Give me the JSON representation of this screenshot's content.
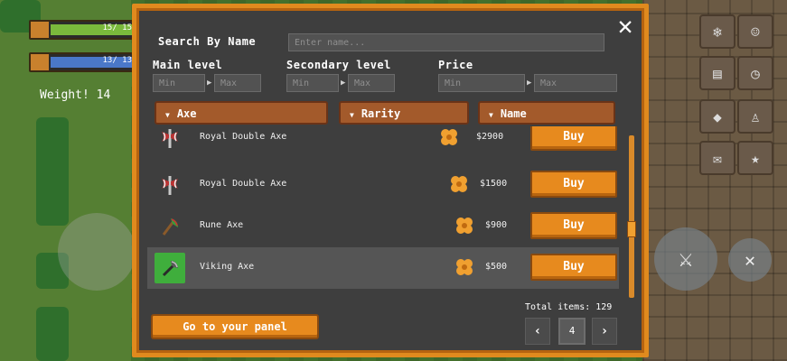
{
  "hud": {
    "health_text": "15/ 15",
    "mana_text": "13/ 13",
    "weight_label": "Weight! 14"
  },
  "shop": {
    "close_label": "✕",
    "search": {
      "label": "Search By Name",
      "placeholder": "Enter name..."
    },
    "filters": {
      "main_level": {
        "label": "Main level",
        "min_placeholder": "Min",
        "max_placeholder": "Max"
      },
      "secondary_level": {
        "label": "Secondary level",
        "min_placeholder": "Min",
        "max_placeholder": "Max"
      },
      "price": {
        "label": "Price",
        "min_placeholder": "Min",
        "max_placeholder": "Max"
      },
      "separator": "▶"
    },
    "dropdowns": [
      {
        "label": "Axe",
        "caret": "▼"
      },
      {
        "label": "Rarity",
        "caret": "▼"
      },
      {
        "label": "Name",
        "caret": "▼"
      }
    ],
    "items": [
      {
        "name": "Royal Double Axe",
        "price": "$2900",
        "buy_label": "Buy",
        "icon": "double-axe-icon",
        "selected": false
      },
      {
        "name": "Royal Double Axe",
        "price": "$1500",
        "buy_label": "Buy",
        "icon": "double-axe-icon",
        "selected": false
      },
      {
        "name": "Rune Axe",
        "price": "$900",
        "buy_label": "Buy",
        "icon": "rune-axe-icon",
        "selected": false
      },
      {
        "name": "Viking Axe",
        "price": "$500",
        "buy_label": "Buy",
        "icon": "viking-axe-icon",
        "selected": true
      }
    ],
    "total_items": "Total items: 129",
    "pagination": {
      "prev_label": "‹",
      "current_page": "4",
      "next_label": "›"
    },
    "go_to_panel_label": "Go to your panel"
  },
  "colors": {
    "panel_border": "#e08a1e",
    "panel_bg": "#3e3e3e",
    "button_orange": "#e78a1e",
    "dropdown_brown": "#a35a2b",
    "selected_thumb": "#3fae3c"
  }
}
